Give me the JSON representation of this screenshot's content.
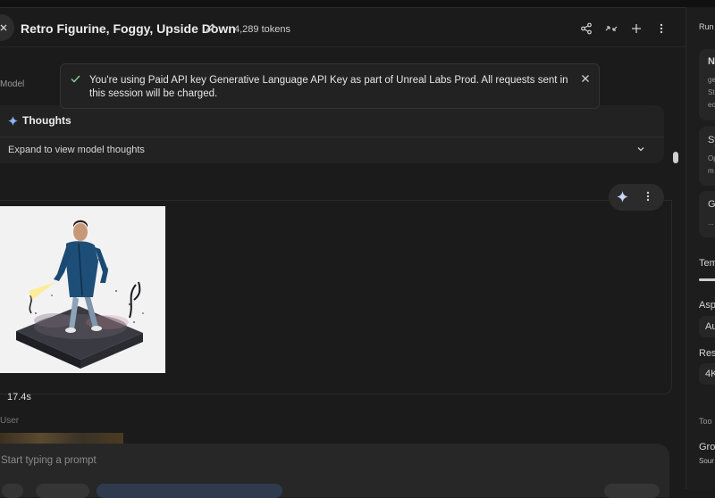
{
  "header": {
    "title": "Retro Figurine, Foggy, Upside Down",
    "token_count": "4,289 tokens"
  },
  "toast": {
    "message": "You're using Paid API key Generative Language API Key as part of Unreal Labs Prod. All requests sent in this session will be charged."
  },
  "chat": {
    "model_label": "Model",
    "thoughts_title": "Thoughts",
    "thoughts_expand": "Expand to view model thoughts",
    "response_time": "17.4s",
    "user_label": "User"
  },
  "prompt": {
    "placeholder": "Start typing a prompt"
  },
  "right_panel": {
    "run_settings": "Run",
    "card1_title": "N",
    "card1_line1": "ge",
    "card1_line2": "St",
    "card1_line3": "ec",
    "card2_title": "Sy",
    "card2_line1": "Op",
    "card2_line2": "m",
    "card3_title": "G",
    "card3_line1": "...",
    "temperature": "Tem",
    "aspect": "Asp",
    "aspect_value": "Au",
    "resolution": "Res",
    "resolution_value": "4K",
    "tools": "Too",
    "grounding": "Gro",
    "grounding_source": "Sour"
  },
  "icons": {
    "back": "close-icon",
    "edit": "pencil-icon",
    "share": "share-icon",
    "compare": "compare-arrows-icon",
    "new": "plus-icon",
    "more": "more-vert-icon",
    "check": "check-icon",
    "close": "close-icon",
    "sparkle": "sparkle-icon",
    "chevron": "chevron-down-icon"
  },
  "colors": {
    "background": "#1b1b1b",
    "panel": "#222222",
    "accent": "#8ab4f8",
    "success": "#81c995"
  }
}
